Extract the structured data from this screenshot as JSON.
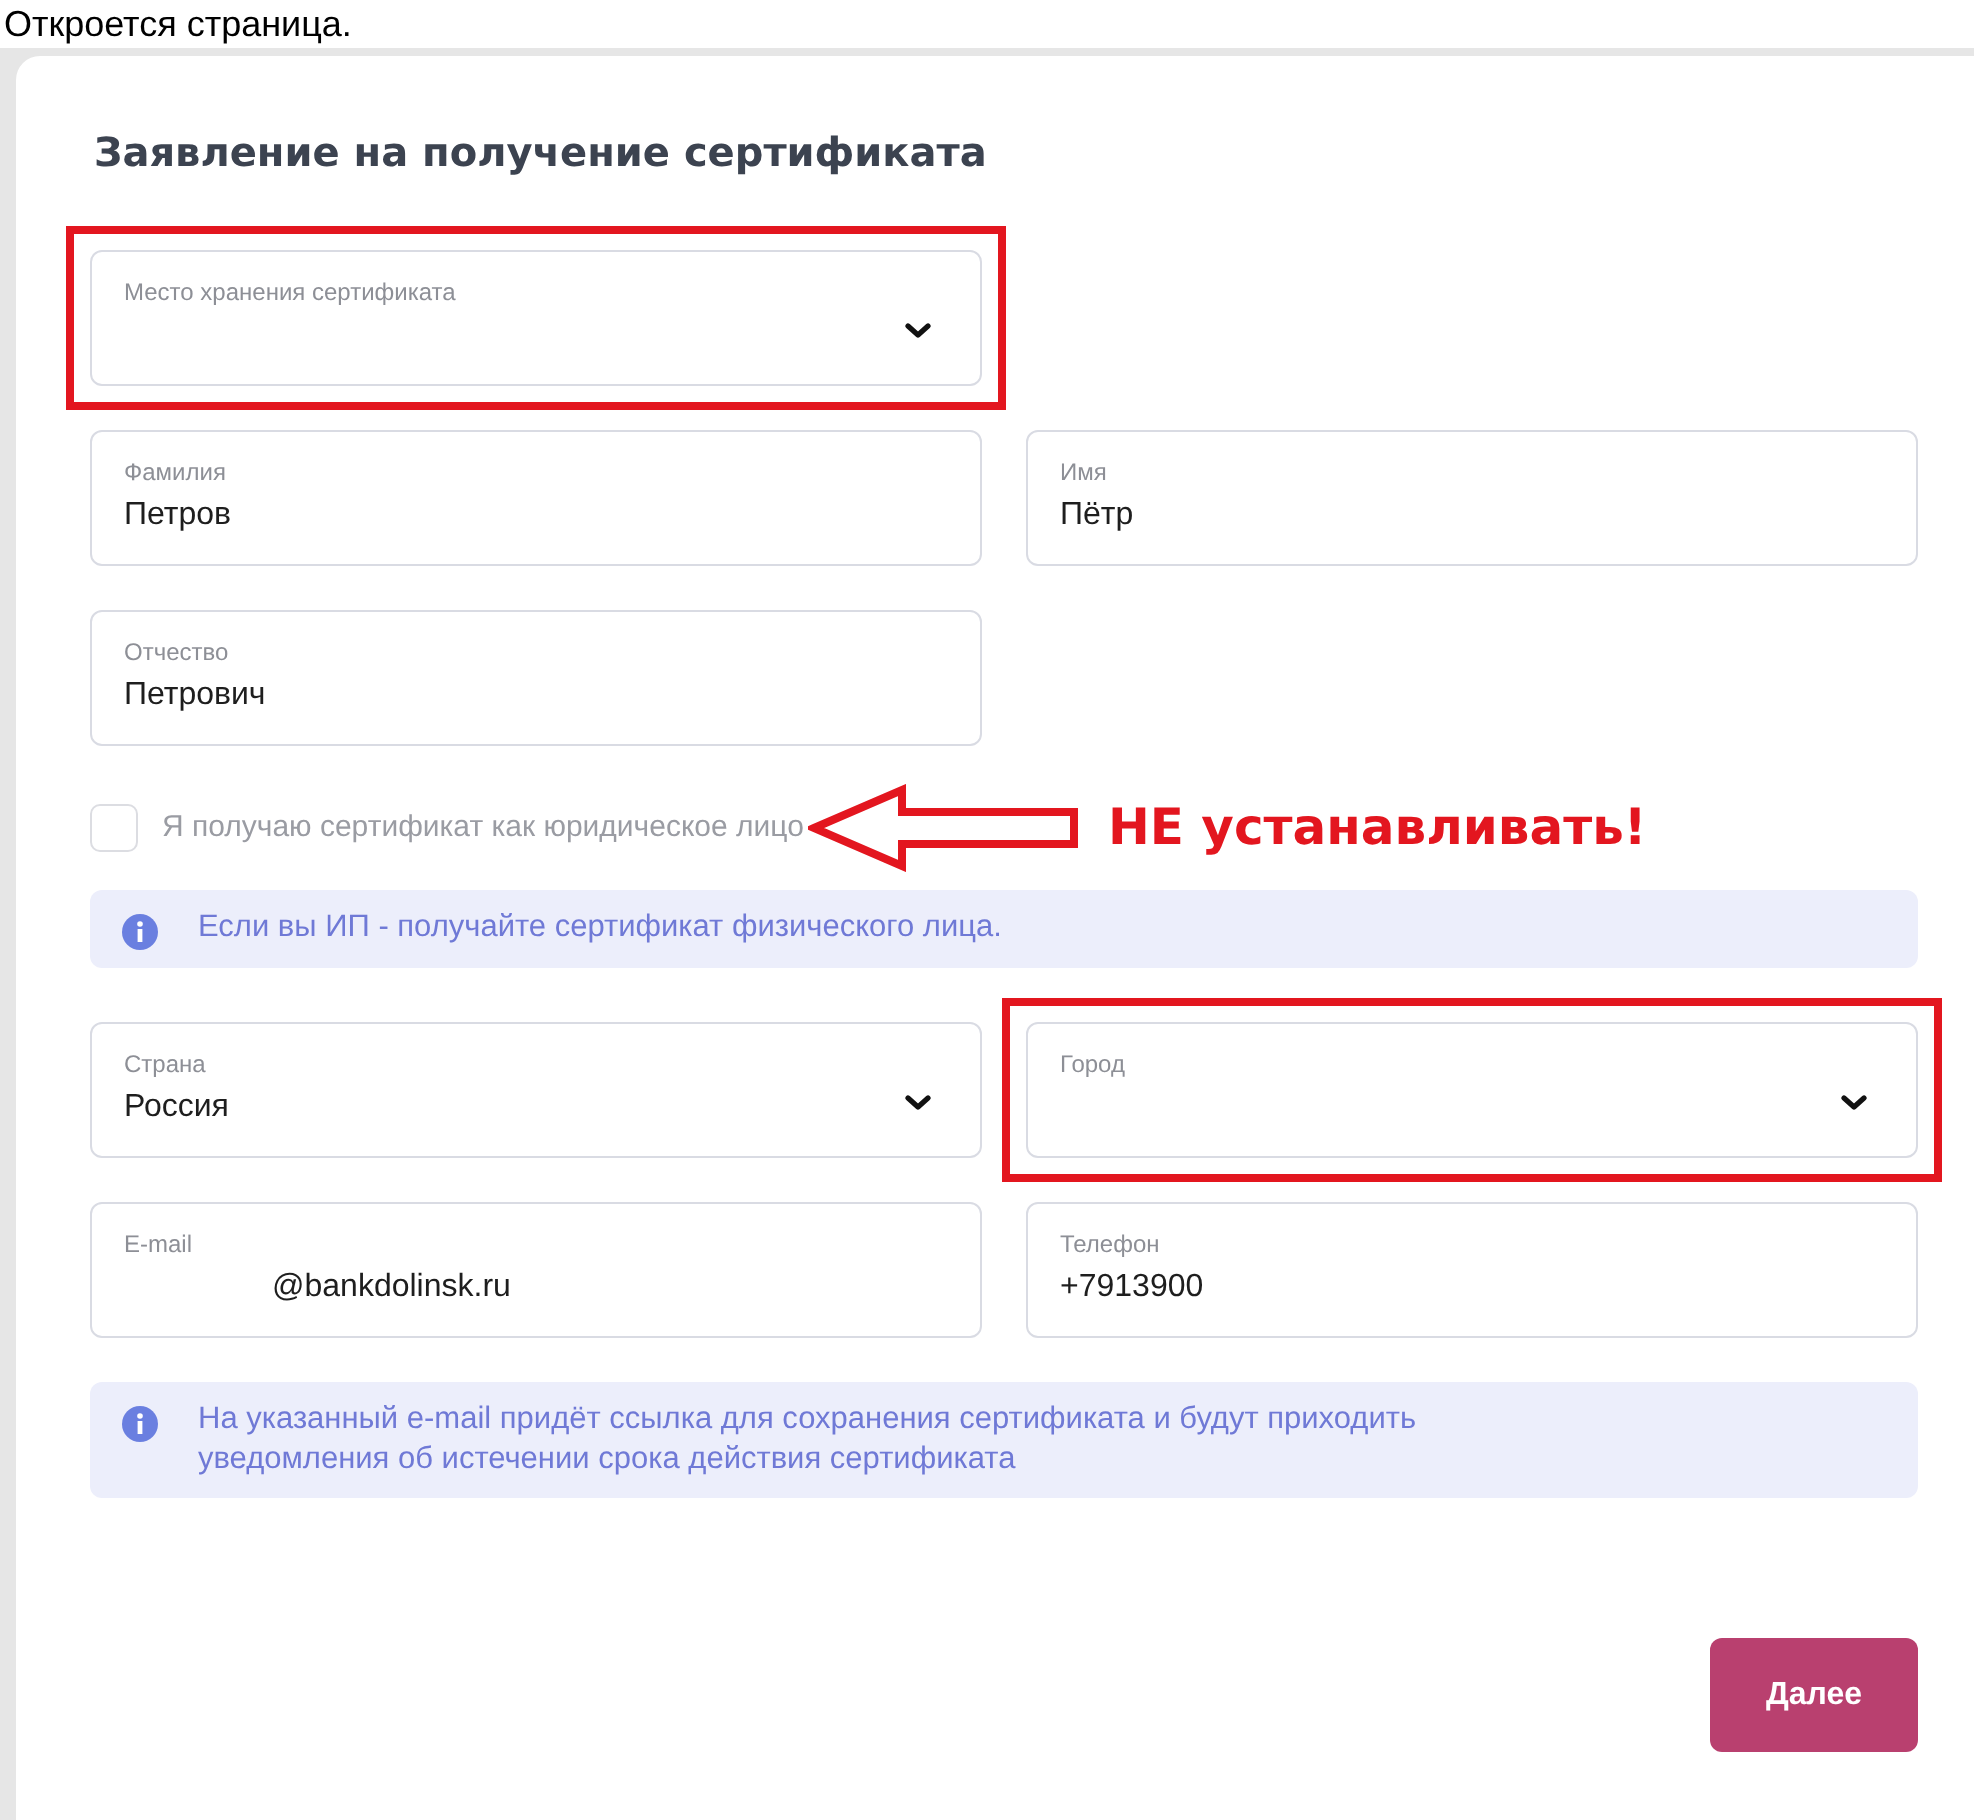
{
  "intro_text": "Откроется страница.",
  "form": {
    "title": "Заявление на получение сертификата",
    "rows": [
      [
        {
          "label": "Место хранения сертификата",
          "kind": "select",
          "highlighted": true
        }
      ],
      [
        {
          "label": "Фамилия",
          "value": "Петров",
          "kind": "text",
          "highlighted": false
        },
        {
          "label": "Имя",
          "value": "Пётр",
          "kind": "text",
          "highlighted": false
        }
      ],
      [
        {
          "label": "Отчество",
          "value": "Петрович",
          "kind": "text",
          "highlighted": false
        }
      ]
    ],
    "legal_entity_checkbox": {
      "label": "Я получаю сертификат как юридическое лицо",
      "checked": false
    },
    "annotation": {
      "text": "НЕ устанавливать!"
    },
    "info_1": "Если вы ИП - получайте сертификат физического лица.",
    "rows_2": [
      [
        {
          "label": "Страна",
          "value": "Россия",
          "kind": "select",
          "highlighted": false
        },
        {
          "label": "Город",
          "kind": "select",
          "highlighted": true
        }
      ],
      [
        {
          "label": "E-mail",
          "value": "@bankdolinsk.ru",
          "kind": "text",
          "highlighted": false,
          "redacted_prefix": true
        },
        {
          "label": "Телефон",
          "value": "+7913900",
          "kind": "text",
          "highlighted": false
        }
      ]
    ],
    "info_2": "На указанный e-mail придёт ссылка для сохранения сертификата и будут приходить уведомления об истечении срока действия сертификата",
    "next_button": "Далее"
  }
}
